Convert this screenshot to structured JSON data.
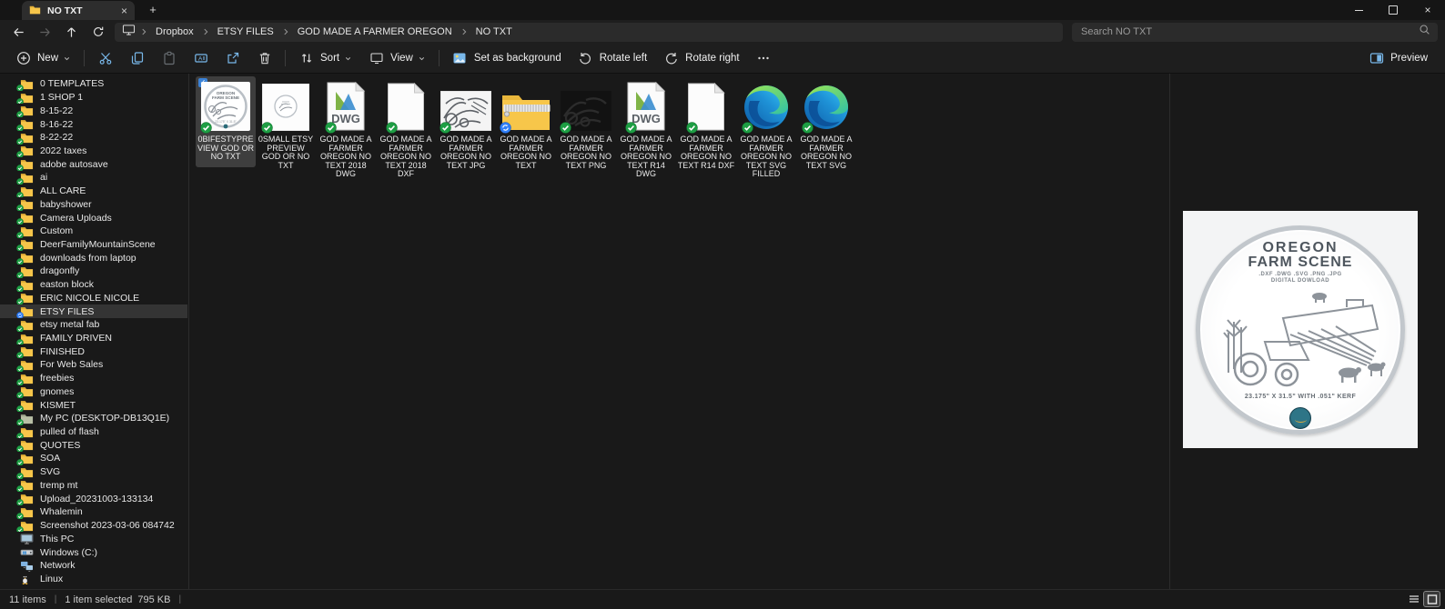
{
  "titlebar": {
    "tab_title": "NO TXT"
  },
  "navigation": {
    "breadcrumb_segments": [
      "Dropbox",
      "ETSY FILES",
      "GOD MADE A FARMER OREGON",
      "NO TXT"
    ],
    "search_placeholder": "Search NO TXT"
  },
  "toolbar": {
    "new": "New",
    "sort": "Sort",
    "view": "View",
    "set_as_background": "Set as background",
    "rotate_left": "Rotate left",
    "rotate_right": "Rotate right",
    "more": "•••",
    "preview": "Preview"
  },
  "sidebar": {
    "items": [
      {
        "label": "0 TEMPLATES",
        "icon": "folder-icon",
        "badge": "synced"
      },
      {
        "label": "1 SHOP 1",
        "icon": "folder-icon",
        "badge": "synced"
      },
      {
        "label": "8-15-22",
        "icon": "folder-icon",
        "badge": "synced"
      },
      {
        "label": "8-16-22",
        "icon": "folder-icon",
        "badge": "synced"
      },
      {
        "label": "8-22-22",
        "icon": "folder-icon",
        "badge": "synced"
      },
      {
        "label": "2022 taxes",
        "icon": "folder-icon",
        "badge": "synced"
      },
      {
        "label": "adobe autosave",
        "icon": "folder-icon",
        "badge": "synced"
      },
      {
        "label": "ai",
        "icon": "folder-icon",
        "badge": "synced"
      },
      {
        "label": "ALL CARE",
        "icon": "folder-icon",
        "badge": "synced"
      },
      {
        "label": "babyshower",
        "icon": "folder-icon",
        "badge": "synced"
      },
      {
        "label": "Camera Uploads",
        "icon": "folder-icon",
        "badge": "synced"
      },
      {
        "label": "Custom",
        "icon": "folder-icon",
        "badge": "synced"
      },
      {
        "label": "DeerFamilyMountainScene",
        "icon": "folder-icon",
        "badge": "synced"
      },
      {
        "label": "downloads from laptop",
        "icon": "folder-icon",
        "badge": "synced"
      },
      {
        "label": "dragonfly",
        "icon": "folder-icon",
        "badge": "synced"
      },
      {
        "label": "easton block",
        "icon": "folder-icon",
        "badge": "synced"
      },
      {
        "label": "ERIC NICOLE NICOLE",
        "icon": "folder-icon",
        "badge": "synced"
      },
      {
        "label": "ETSY FILES",
        "icon": "folder-icon",
        "badge": "syncing",
        "selected": true
      },
      {
        "label": "etsy metal fab",
        "icon": "folder-icon",
        "badge": "synced"
      },
      {
        "label": "FAMILY DRIVEN",
        "icon": "folder-icon",
        "badge": "synced"
      },
      {
        "label": "FINISHED",
        "icon": "folder-icon",
        "badge": "synced"
      },
      {
        "label": "For Web Sales",
        "icon": "folder-icon",
        "badge": "synced"
      },
      {
        "label": "freebies",
        "icon": "folder-icon",
        "badge": "synced"
      },
      {
        "label": "gnomes",
        "icon": "folder-icon",
        "badge": "synced"
      },
      {
        "label": "KISMET",
        "icon": "folder-icon",
        "badge": "synced"
      },
      {
        "label": "My PC (DESKTOP-DB13Q1E)",
        "icon": "folder-gray-icon",
        "badge": "synced"
      },
      {
        "label": "pulled of flash",
        "icon": "folder-icon",
        "badge": "synced"
      },
      {
        "label": "QUOTES",
        "icon": "folder-icon",
        "badge": "synced"
      },
      {
        "label": "SOA",
        "icon": "folder-icon",
        "badge": "synced"
      },
      {
        "label": "SVG",
        "icon": "folder-icon",
        "badge": "synced"
      },
      {
        "label": "tremp mt",
        "icon": "folder-icon",
        "badge": "synced"
      },
      {
        "label": "Upload_20231003-133134",
        "icon": "folder-icon",
        "badge": "synced"
      },
      {
        "label": "Whalemin",
        "icon": "folder-icon",
        "badge": "synced"
      },
      {
        "label": "Screenshot 2023-03-06 084742",
        "icon": "folder-icon",
        "badge": "synced"
      },
      {
        "label": "This PC",
        "icon": "monitor-icon"
      },
      {
        "label": "Windows (C:)",
        "icon": "drive-icon"
      },
      {
        "label": "Network",
        "icon": "network-icon"
      },
      {
        "label": "Linux",
        "icon": "linux-icon"
      }
    ]
  },
  "files": {
    "items": [
      {
        "name": "0BIFESTYPREVIEW GOD OR NO TXT",
        "icon": "preview-thumbnail",
        "badge": "synced",
        "selected": true
      },
      {
        "name": "0SMALL ETSY PREVIEW GOD OR NO TXT",
        "icon": "small-preview-thumbnail",
        "badge": "synced"
      },
      {
        "name": "GOD MADE A FARMER OREGON NO TEXT 2018 DWG",
        "icon": "dwg-file-icon",
        "badge": "synced"
      },
      {
        "name": "GOD MADE A FARMER OREGON NO TEXT 2018 DXF",
        "icon": "dxf-file-icon",
        "badge": "synced"
      },
      {
        "name": "GOD MADE A FARMER OREGON NO TEXT JPG",
        "icon": "jpg-thumbnail",
        "badge": "synced"
      },
      {
        "name": "GOD MADE A FARMER OREGON NO TEXT",
        "icon": "zip-folder-icon",
        "badge": "syncing"
      },
      {
        "name": "GOD MADE A FARMER OREGON NO TEXT PNG",
        "icon": "png-thumbnail",
        "badge": "synced"
      },
      {
        "name": "GOD MADE A FARMER OREGON NO TEXT R14 DWG",
        "icon": "dwg-file-icon",
        "badge": "synced"
      },
      {
        "name": "GOD MADE A FARMER OREGON NO TEXT R14 DXF",
        "icon": "dxf-file-icon",
        "badge": "synced"
      },
      {
        "name": "GOD MADE A FARMER OREGON NO TEXT SVG FILLED",
        "icon": "edge-logo-icon",
        "badge": "synced"
      },
      {
        "name": "GOD MADE A FARMER OREGON NO TEXT SVG",
        "icon": "edge-logo-icon",
        "badge": "synced"
      }
    ]
  },
  "preview_panel": {
    "heading1": "OREGON",
    "heading2": "FARM SCENE",
    "formats": ".DXF .DWG .SVG .PNG .JPG",
    "subheading": "DIGITAL DOWLOAD",
    "dimensions": "23.175\" X 31.5\" WITH .051\" KERF"
  },
  "statusbar": {
    "item_count": "11 items",
    "selection": "1 item selected",
    "selection_size": "795 KB"
  },
  "colors": {
    "accent_blue": "#79b8ea",
    "folder_yellow": "#f7c64a",
    "synced_green": "#1e9e44",
    "syncing_blue": "#2f7ef7",
    "selection_bg": "#3e3e3e"
  }
}
